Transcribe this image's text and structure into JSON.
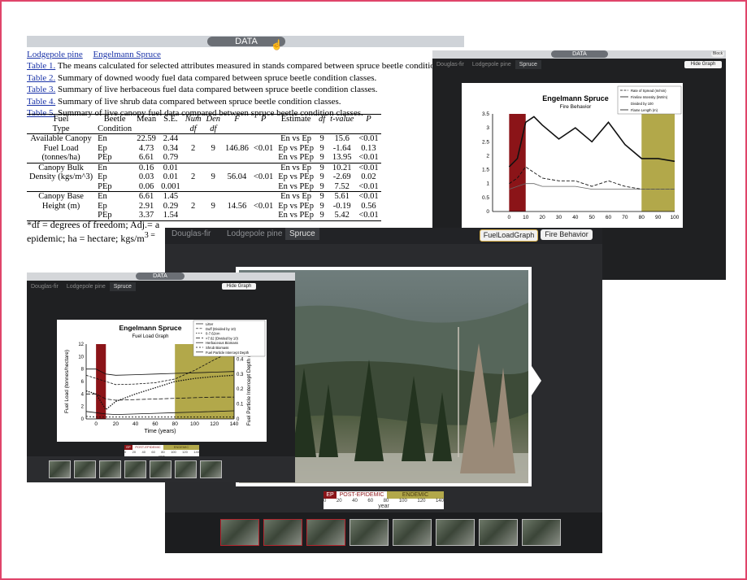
{
  "colors": {
    "frame": "#e0446a",
    "ep": "#8b1418",
    "endemic": "#b2a84a",
    "link": "#1a33a8"
  },
  "data_page": {
    "data_tab": "DATA",
    "species_links": [
      "Lodgepole pine",
      "Engelmann Spruce"
    ],
    "tables": [
      {
        "link": "Table 1.",
        "text": " The means calculated for selected attributes measured in stands compared between spruce beetle condition classe"
      },
      {
        "link": "Table 2.",
        "text": " Summary of downed woody fuel data compared between spruce beetle condition classes."
      },
      {
        "link": "Table 3.",
        "text": " Summary of live herbaceous fuel data compared between spruce beetle condition classes."
      },
      {
        "link": "Table 4.",
        "text": " Summary of live shrub data compared between spruce beetle condition classes."
      },
      {
        "link": "Table 5.",
        "text": " Summary of live canopy fuel data compared between spruce beetle condition classes."
      }
    ],
    "headers": {
      "fuel": "Fuel",
      "type": "Type",
      "beetle": "Beetle",
      "condition": "Condition",
      "mean": "Mean",
      "se": "S.E.",
      "num": "Num",
      "df": "df",
      "den": "Den",
      "f": "F",
      "p": "P",
      "estimate": "Estimate",
      "df2": "df",
      "tvalue": "t-value",
      "p2": "P"
    },
    "groups": [
      {
        "name": [
          "Available Canopy",
          "Fuel Load",
          "(tonnes/ha)"
        ],
        "num": "2",
        "den": "9",
        "f": "146.86",
        "p": "<0.01",
        "rows": [
          {
            "c": "En",
            "mean": "22.59",
            "se": "2.44",
            "est": "En vs Ep",
            "df": "9",
            "t": "15.6",
            "p": "<0.01"
          },
          {
            "c": "Ep",
            "mean": "4.73",
            "se": "0.34",
            "est": "Ep vs PEp",
            "df": "9",
            "t": "-1.64",
            "p": "0.13"
          },
          {
            "c": "PEp",
            "mean": "6.61",
            "se": "0.79",
            "est": "En vs PEp",
            "df": "9",
            "t": "13.95",
            "p": "<0.01"
          }
        ]
      },
      {
        "name": [
          "Canopy Bulk",
          "Density (kgs/m^3)"
        ],
        "num": "2",
        "den": "9",
        "f": "56.04",
        "p": "<0.01",
        "rows": [
          {
            "c": "En",
            "mean": "0.16",
            "se": "0.01",
            "est": "En vs Ep",
            "df": "9",
            "t": "10.21",
            "p": "<0.01"
          },
          {
            "c": "Ep",
            "mean": "0.03",
            "se": "0.01",
            "est": "Ep vs PEp",
            "df": "9",
            "t": "-2.69",
            "p": "0.02"
          },
          {
            "c": "PEp",
            "mean": "0.06",
            "se": "0.001",
            "est": "En vs PEp",
            "df": "9",
            "t": "7.52",
            "p": "<0.01"
          }
        ]
      },
      {
        "name": [
          "Canopy Base",
          "Height (m)"
        ],
        "num": "2",
        "den": "9",
        "f": "14.56",
        "p": "<0.01",
        "rows": [
          {
            "c": "En",
            "mean": "6.61",
            "se": "1.45",
            "est": "En vs Ep",
            "df": "9",
            "t": "5.61",
            "p": "<0.01"
          },
          {
            "c": "Ep",
            "mean": "2.91",
            "se": "0.29",
            "est": "Ep vs PEp",
            "df": "9",
            "t": "-0.19",
            "p": "0.56"
          },
          {
            "c": "PEp",
            "mean": "3.37",
            "se": "1.54",
            "est": "En vs PEp",
            "df": "9",
            "t": "5.42",
            "p": "<0.01"
          }
        ]
      }
    ],
    "footnote_1": "*df = degrees of freedom; Adj.= a",
    "footnote_2": "epidemic; ha = hectare; kgs/m",
    "footnote_3": "3 ="
  },
  "fire_window": {
    "data_tab": "DATA",
    "tabs": [
      "Douglas-fir",
      "Lodgepole pine",
      "Spruce"
    ],
    "hide_button": "Hide Graph",
    "corner_button": "Block",
    "chart_title": "Engelmann Spruce",
    "chart_subtitle": "Fire Behavior",
    "legend": [
      "Rate of Spread (m/min)",
      "Fireline Intensity (kW/m)",
      "Divided by 100",
      "Flame Length (m)"
    ]
  },
  "main_window": {
    "tabs": [
      "Douglas-fir",
      "Lodgepole pine",
      "Spruce"
    ],
    "fuel_button": "FuelLoadGraph",
    "fire_button": "Fire Behavior",
    "scale": {
      "ep": "EP",
      "post": "POST-EPIDEMIC",
      "endemic": "ENDEMIC",
      "ticks": [
        "0",
        "20",
        "40",
        "60",
        "80",
        "100",
        "120",
        "140"
      ],
      "year": "year"
    }
  },
  "fuel_window": {
    "data_tab": "DATA",
    "tabs": [
      "Douglas-fir",
      "Lodgepole pine",
      "Spruce"
    ],
    "hide_button": "Hide Graph",
    "chart_title": "Engelmann Spruce",
    "chart_subtitle": "Fuel Load Graph",
    "ylabel_left": "Fuel Load (tonnes/hectare)",
    "ylabel_right": "Fuel Particle Intercept Depth (meters)",
    "xlabel": "Time (years)",
    "legend": [
      "Litter",
      "Duff (Divided by 10)",
      "0-7.62cm",
      ">7.62 (Divided by 10)",
      "Herbaceous Biomass",
      "Shrub Biomass",
      "Fuel Particle Intercept Depth"
    ],
    "scale": {
      "ep": "EP",
      "post": "POST-EPIDEMIC",
      "endemic": "ENDEMIC",
      "ticks": [
        "0",
        "20",
        "40",
        "60",
        "80",
        "100",
        "120",
        "140"
      ],
      "year": "year"
    }
  },
  "chart_data": [
    {
      "type": "line",
      "title": "Engelmann Spruce",
      "subtitle": "Fire Behavior",
      "x": [
        0,
        5,
        10,
        15,
        20,
        30,
        40,
        50,
        60,
        70,
        80,
        90,
        100
      ],
      "xlim": [
        -10,
        100
      ],
      "ylim": [
        0,
        3.5
      ],
      "xticks": [
        "0",
        "10",
        "20",
        "30",
        "40",
        "50",
        "60",
        "70",
        "80",
        "90",
        "100"
      ],
      "yticks": [
        "0",
        "0.5",
        "1",
        "1.5",
        "2",
        "2.5",
        "3",
        "3.5"
      ],
      "series": [
        {
          "name": "Fireline Intensity (kW/m) Divided by 100",
          "values": [
            1.6,
            1.9,
            3.2,
            3.4,
            3.1,
            2.6,
            3.0,
            2.5,
            3.2,
            2.4,
            1.9,
            1.9,
            1.8
          ]
        },
        {
          "name": "Rate of Spread (m/min)",
          "values": [
            1.0,
            1.2,
            1.6,
            1.4,
            1.2,
            1.1,
            1.1,
            0.9,
            1.1,
            0.9,
            0.8,
            0.8,
            0.8
          ]
        },
        {
          "name": "Flame Length (m)",
          "values": [
            0.8,
            0.9,
            1.0,
            1.0,
            0.9,
            0.9,
            0.9,
            0.8,
            0.8,
            0.8,
            0.8,
            0.8,
            0.8
          ]
        }
      ]
    },
    {
      "type": "line",
      "title": "Engelmann Spruce",
      "subtitle": "Fuel Load Graph",
      "xlabel": "Time (years)",
      "ylabel": "Fuel Load (tonnes/hectare)",
      "ylabel_right": "Fuel Particle Intercept Depth (meters)",
      "x": [
        -10,
        0,
        10,
        20,
        40,
        60,
        80,
        100,
        120,
        140
      ],
      "xlim": [
        -10,
        140
      ],
      "ylim": [
        0,
        12
      ],
      "ylim_right": [
        0,
        0.5
      ],
      "xticks": [
        "0",
        "20",
        "40",
        "60",
        "80",
        "100",
        "120",
        "140"
      ],
      "yticks": [
        "0",
        "2",
        "4",
        "6",
        "8",
        "10",
        "12"
      ],
      "yticks_right": [
        "0",
        "0.1",
        "0.2",
        "0.3",
        "0.4",
        "0.5"
      ],
      "series": [
        {
          "name": "Litter",
          "values": [
            8.0,
            8.0,
            7.2,
            7.0,
            7.1,
            7.2,
            7.3,
            7.4,
            7.5,
            7.6
          ]
        },
        {
          "name": "Duff (Divided by 10)",
          "values": [
            7.0,
            6.5,
            6.0,
            5.5,
            5.6,
            5.8,
            6.4,
            7.8,
            9.5,
            11.0
          ]
        },
        {
          "name": "0-7.62cm",
          "values": [
            4.5,
            4.0,
            1.5,
            2.8,
            4.0,
            5.0,
            6.0,
            6.5,
            6.8,
            7.0
          ]
        },
        {
          "name": ">7.62 (Divided by 10)",
          "values": [
            4.0,
            4.0,
            3.2,
            3.0,
            3.1,
            3.2,
            3.3,
            3.4,
            3.5,
            3.5
          ]
        },
        {
          "name": "Shrub Biomass",
          "values": [
            1.2,
            1.0,
            0.8,
            0.7,
            0.8,
            0.9,
            1.0,
            1.1,
            1.2,
            1.3
          ]
        },
        {
          "name": "Herbaceous Biomass",
          "values": [
            0.4,
            0.3,
            0.3,
            0.3,
            0.3,
            0.3,
            0.3,
            0.3,
            0.3,
            0.3
          ]
        }
      ]
    }
  ]
}
